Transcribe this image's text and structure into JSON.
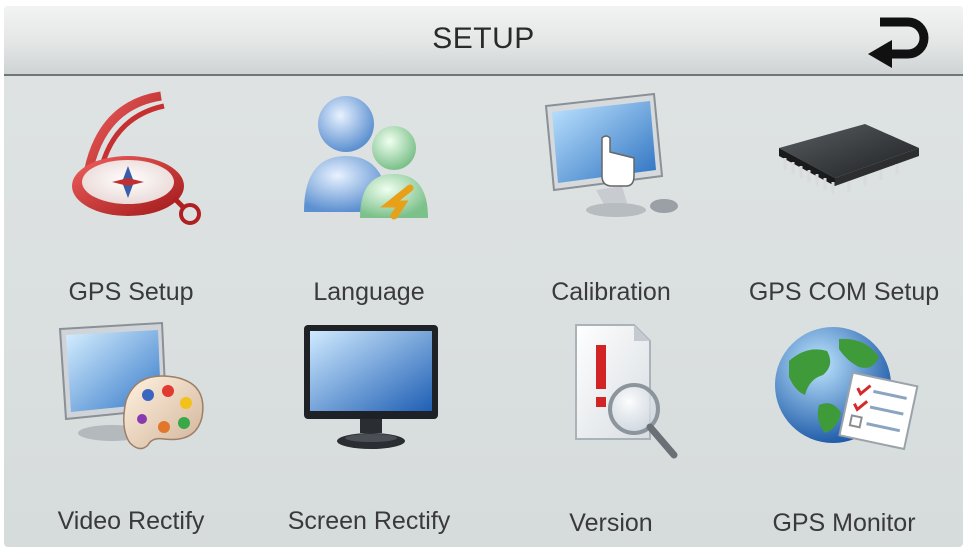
{
  "header": {
    "title": "SETUP",
    "back_icon": "return-arrow-icon"
  },
  "menu": {
    "items": [
      {
        "label": "GPS Setup",
        "icon": "compass-icon"
      },
      {
        "label": "Language",
        "icon": "users-language-icon"
      },
      {
        "label": "Calibration",
        "icon": "touch-calibration-monitor-icon"
      },
      {
        "label": "GPS COM Setup",
        "icon": "chip-icon"
      },
      {
        "label": "Video Rectify",
        "icon": "monitor-palette-icon"
      },
      {
        "label": "Screen Rectify",
        "icon": "monitor-icon"
      },
      {
        "label": "Version",
        "icon": "document-magnifier-icon"
      },
      {
        "label": "GPS Monitor",
        "icon": "globe-checklist-icon"
      }
    ]
  }
}
